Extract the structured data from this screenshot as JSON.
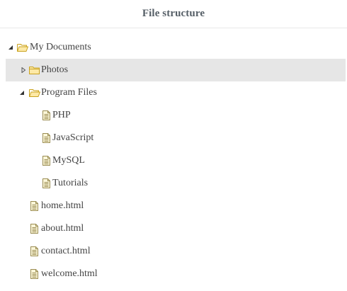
{
  "header": {
    "title": "File structure"
  },
  "tree": {
    "root": {
      "label": "My Documents",
      "expanded": true,
      "icon": "folder-open-icon",
      "children": {
        "photos": {
          "label": "Photos",
          "expanded": false,
          "icon": "folder-icon",
          "selected": true
        },
        "program_files": {
          "label": "Program Files",
          "expanded": true,
          "icon": "folder-open-icon",
          "children": {
            "php": {
              "label": "PHP",
              "icon": "file-icon"
            },
            "javascript": {
              "label": "JavaScript",
              "icon": "file-icon"
            },
            "mysql": {
              "label": "MySQL",
              "icon": "file-icon"
            },
            "tutorials": {
              "label": "Tutorials",
              "icon": "file-icon"
            }
          }
        },
        "home": {
          "label": "home.html",
          "icon": "file-icon"
        },
        "about": {
          "label": "about.html",
          "icon": "file-icon"
        },
        "contact": {
          "label": "contact.html",
          "icon": "file-icon"
        },
        "welcome": {
          "label": "welcome.html",
          "icon": "file-icon"
        }
      }
    }
  },
  "colors": {
    "selected_row": "#e6e6e6",
    "folder_fill": "#fde9a6",
    "folder_stroke": "#c9a21f",
    "file_fill": "#fbf6d8",
    "file_stroke": "#9a8c52",
    "text": "#444444",
    "title": "#555e66"
  }
}
